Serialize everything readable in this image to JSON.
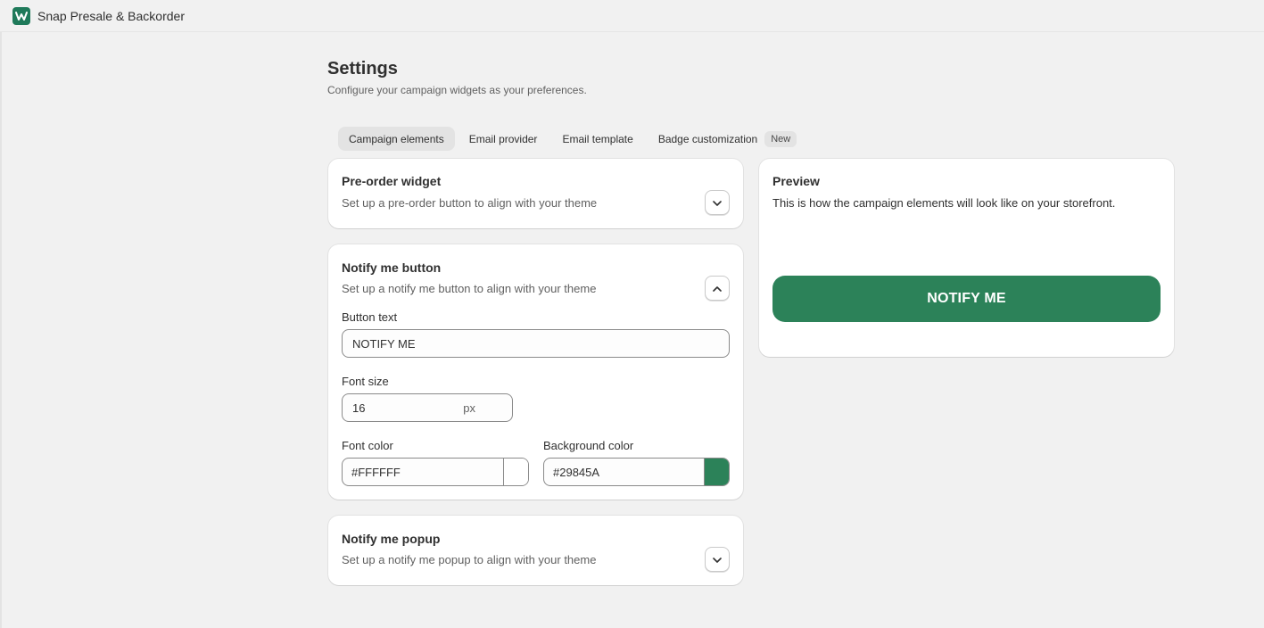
{
  "app": {
    "title": "Snap Presale & Backorder",
    "logo_icon": "snap-logo-icon"
  },
  "page": {
    "title": "Settings",
    "subtitle": "Configure your campaign widgets as your preferences."
  },
  "tabs": [
    {
      "label": "Campaign elements",
      "active": true
    },
    {
      "label": "Email provider",
      "active": false
    },
    {
      "label": "Email template",
      "active": false
    },
    {
      "label": "Badge customization",
      "active": false,
      "badge": "New"
    }
  ],
  "preorder_widget": {
    "title": "Pre-order widget",
    "subtitle": "Set up a pre-order button to align with your theme",
    "toggle_icon": "chevron-down-icon"
  },
  "notify_button": {
    "title": "Notify me button",
    "subtitle": "Set up a notify me button to align with your theme",
    "toggle_icon": "chevron-up-icon",
    "button_text_label": "Button text",
    "button_text_value": "NOTIFY ME",
    "font_size_label": "Font size",
    "font_size_value": "16",
    "font_size_suffix": "px",
    "font_color_label": "Font color",
    "font_color_value": "#FFFFFF",
    "bg_color_label": "Background color",
    "bg_color_value": "#29845A"
  },
  "notify_popup": {
    "title": "Notify me popup",
    "subtitle": "Set up a notify me popup to align with your theme",
    "toggle_icon": "chevron-down-icon"
  },
  "preview": {
    "title": "Preview",
    "subtitle": "This is how the campaign elements will look like on your storefront.",
    "button_label": "NOTIFY ME"
  },
  "colors": {
    "brand": "#1f7a5a",
    "notify_bg": "#2c8259",
    "notify_text": "#ffffff"
  }
}
